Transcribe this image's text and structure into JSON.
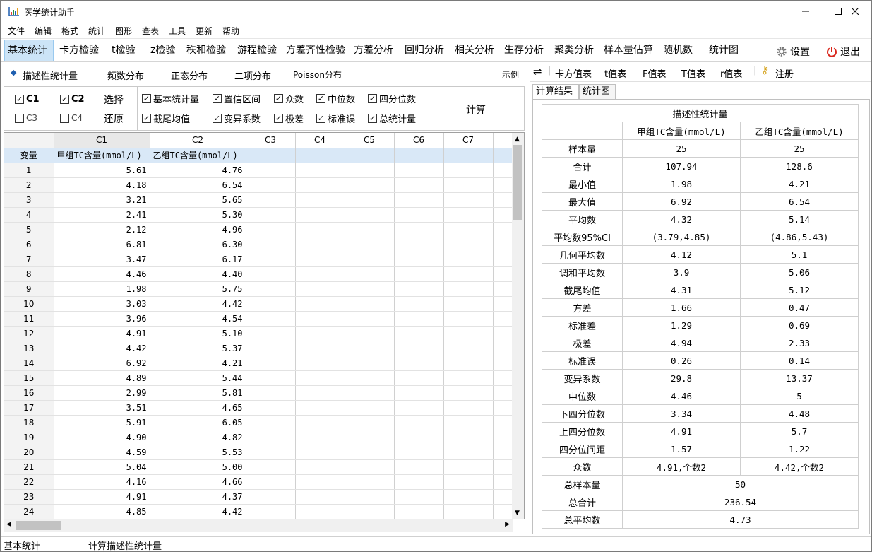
{
  "window": {
    "title": "医学统计助手"
  },
  "menu": [
    "文件",
    "编辑",
    "格式",
    "统计",
    "图形",
    "查表",
    "工具",
    "更新",
    "帮助"
  ],
  "modules": [
    "基本统计",
    "卡方检验",
    "t检验",
    "z检验",
    "秩和检验",
    "游程检验",
    "方差齐性检验",
    "方差分析",
    "回归分析",
    "相关分析",
    "生存分析",
    "聚类分析",
    "样本量估算",
    "随机数",
    "统计图"
  ],
  "settings_label": "设置",
  "exit_label": "退出",
  "subtabs": {
    "t1": "描述性统计量",
    "t2": "频数分布",
    "t3": "正态分布",
    "t4": "二项分布",
    "t5": "Poisson分布",
    "example": "示例"
  },
  "columns_opts": {
    "c1": "C1",
    "c2": "C2",
    "c3": "C3",
    "c4": "C4",
    "select": "选择",
    "reset": "还原"
  },
  "stat_opts": {
    "o1": "基本统计量",
    "o2": "置信区间",
    "o3": "众数",
    "o4": "中位数",
    "o5": "四分位数",
    "o6": "截尾均值",
    "o7": "变异系数",
    "o8": "极差",
    "o9": "标准误",
    "o10": "总统计量"
  },
  "calc_label": "计算",
  "grid": {
    "col_headers": [
      "C1",
      "C2",
      "C3",
      "C4",
      "C5",
      "C6",
      "C7"
    ],
    "var_label": "变量",
    "var_names": [
      "甲组TC含量(mmol/L)",
      "乙组TC含量(mmol/L)"
    ],
    "rows": [
      [
        "1",
        "5.61",
        "4.76"
      ],
      [
        "2",
        "4.18",
        "6.54"
      ],
      [
        "3",
        "3.21",
        "5.65"
      ],
      [
        "4",
        "2.41",
        "5.30"
      ],
      [
        "5",
        "2.12",
        "4.96"
      ],
      [
        "6",
        "6.81",
        "6.30"
      ],
      [
        "7",
        "3.47",
        "6.17"
      ],
      [
        "8",
        "4.46",
        "4.40"
      ],
      [
        "9",
        "1.98",
        "5.75"
      ],
      [
        "10",
        "3.03",
        "4.42"
      ],
      [
        "11",
        "3.96",
        "4.54"
      ],
      [
        "12",
        "4.91",
        "5.10"
      ],
      [
        "13",
        "4.42",
        "5.37"
      ],
      [
        "14",
        "6.92",
        "4.21"
      ],
      [
        "15",
        "4.89",
        "5.44"
      ],
      [
        "16",
        "2.99",
        "5.81"
      ],
      [
        "17",
        "3.51",
        "4.65"
      ],
      [
        "18",
        "5.91",
        "6.05"
      ],
      [
        "19",
        "4.90",
        "4.82"
      ],
      [
        "20",
        "4.59",
        "5.53"
      ],
      [
        "21",
        "5.04",
        "5.00"
      ],
      [
        "22",
        "4.16",
        "4.66"
      ],
      [
        "23",
        "4.91",
        "4.37"
      ],
      [
        "24",
        "4.85",
        "4.42"
      ]
    ]
  },
  "table_tools": {
    "t1": "卡方值表",
    "t2": "t值表",
    "t3": "F值表",
    "t4": "T值表",
    "t5": "r值表",
    "register": "注册"
  },
  "result_tabs": {
    "r1": "计算结果",
    "r2": "统计图"
  },
  "results": {
    "title": "描述性统计量",
    "col1": "甲组TC含量(mmol/L)",
    "col2": "乙组TC含量(mmol/L)",
    "rows": [
      [
        "样本量",
        "25",
        "25"
      ],
      [
        "合计",
        "107.94",
        "128.6"
      ],
      [
        "最小值",
        "1.98",
        "4.21"
      ],
      [
        "最大值",
        "6.92",
        "6.54"
      ],
      [
        "平均数",
        "4.32",
        "5.14"
      ],
      [
        "平均数95%CI",
        "(3.79,4.85)",
        "(4.86,5.43)"
      ],
      [
        "几何平均数",
        "4.12",
        "5.1"
      ],
      [
        "调和平均数",
        "3.9",
        "5.06"
      ],
      [
        "截尾均值",
        "4.31",
        "5.12"
      ],
      [
        "方差",
        "1.66",
        "0.47"
      ],
      [
        "标准差",
        "1.29",
        "0.69"
      ],
      [
        "极差",
        "4.94",
        "2.33"
      ],
      [
        "标准误",
        "0.26",
        "0.14"
      ],
      [
        "变异系数",
        "29.8",
        "13.37"
      ],
      [
        "中位数",
        "4.46",
        "5"
      ],
      [
        "下四分位数",
        "3.34",
        "4.48"
      ],
      [
        "上四分位数",
        "4.91",
        "5.7"
      ],
      [
        "四分位间距",
        "1.57",
        "1.22"
      ],
      [
        "众数",
        "4.91,个数2",
        "4.42,个数2"
      ]
    ],
    "totals": [
      [
        "总样本量",
        "50"
      ],
      [
        "总合计",
        "236.54"
      ],
      [
        "总平均数",
        "4.73"
      ]
    ]
  },
  "status": {
    "module": "基本统计",
    "message": "计算描述性统计量"
  }
}
